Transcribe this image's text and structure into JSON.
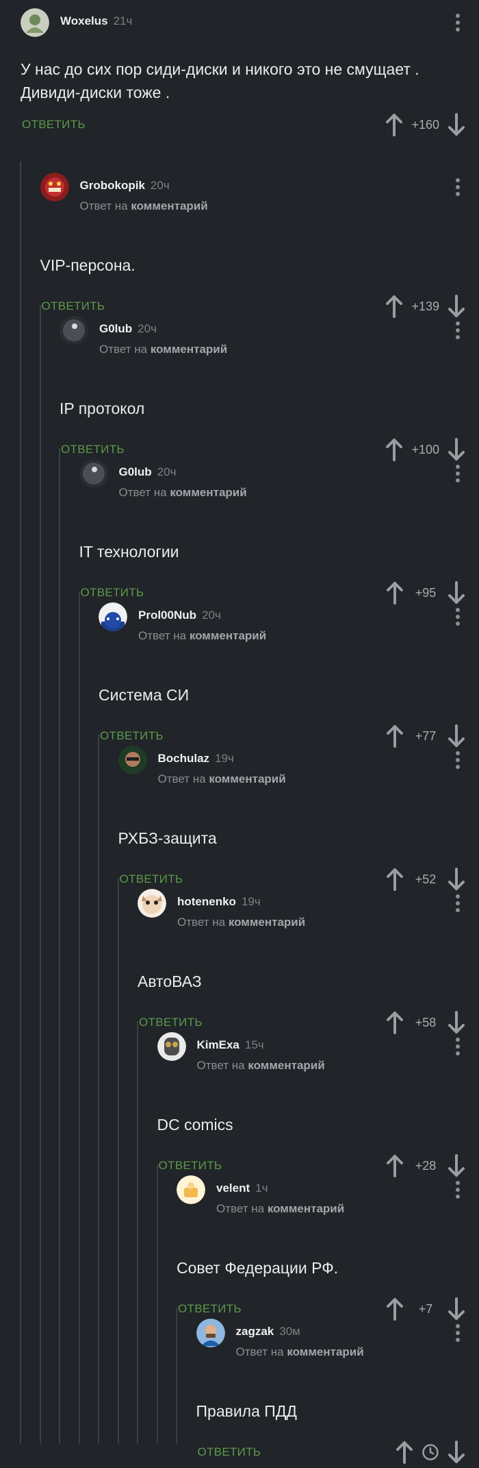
{
  "labels": {
    "reply_to_prefix": "Ответ на",
    "reply_to_target": "комментарий",
    "reply_button": "ОТВЕТИТЬ"
  },
  "comments": [
    {
      "author": "Woxelus",
      "time": "21ч",
      "text_lines": [
        "У нас до сих пор сиди-диски и никого это не смущает .",
        "Дивиди-диски тоже ."
      ],
      "rating": "+160",
      "is_reply": false
    },
    {
      "author": "Grobokopik",
      "time": "20ч",
      "text_lines": [
        "VIP-персона."
      ],
      "rating": "+139",
      "is_reply": true
    },
    {
      "author": "G0lub",
      "time": "20ч",
      "text_lines": [
        "IP протокол"
      ],
      "rating": "+100",
      "is_reply": true
    },
    {
      "author": "G0lub",
      "time": "20ч",
      "text_lines": [
        "IT технологии"
      ],
      "rating": "+95",
      "is_reply": true
    },
    {
      "author": "Prol00Nub",
      "time": "20ч",
      "text_lines": [
        "Система СИ"
      ],
      "rating": "+77",
      "is_reply": true
    },
    {
      "author": "Bochulaz",
      "time": "19ч",
      "text_lines": [
        "РХБЗ-защита"
      ],
      "rating": "+52",
      "is_reply": true
    },
    {
      "author": "hotenenko",
      "time": "19ч",
      "text_lines": [
        "АвтоВАЗ"
      ],
      "rating": "+58",
      "is_reply": true
    },
    {
      "author": "KimExa",
      "time": "15ч",
      "text_lines": [
        "DC comics"
      ],
      "rating": "+28",
      "is_reply": true
    },
    {
      "author": "velent",
      "time": "1ч",
      "text_lines": [
        "Совет Федерации РФ."
      ],
      "rating": "+7",
      "is_reply": true
    },
    {
      "author": "zagzak",
      "time": "30м",
      "text_lines": [
        "Правила ПДД"
      ],
      "rating": "",
      "rating_icon": "clock-icon",
      "is_reply": true
    }
  ],
  "icons": {
    "upvote": "arrow-up-icon",
    "downvote": "arrow-down-icon",
    "more": "more-vertical-icon",
    "pending_rating": "clock-icon"
  },
  "colors": {
    "background": "#212428",
    "reply_button": "#5b9a4c",
    "thread_line": "#3c3f44"
  }
}
